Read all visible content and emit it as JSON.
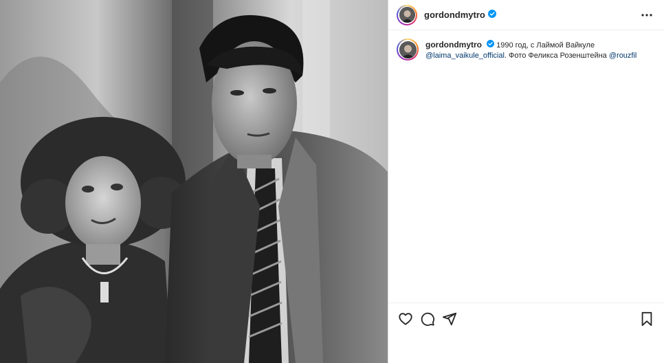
{
  "post": {
    "username": "gordondmytro",
    "verified": true,
    "caption": {
      "text_main": "1990 год, с Лаймой Вайкуле",
      "mention_1": "@laima_vaikule_official",
      "text_mid": ". Фото Феликса Розенштейна ",
      "mention_2": "@rouzfil"
    }
  },
  "icons": {
    "verified": "verified-badge-icon",
    "more": "more-options-icon",
    "like": "heart-icon",
    "comment": "comment-icon",
    "share": "share-icon",
    "save": "bookmark-icon"
  },
  "colors": {
    "verified": "#0095f6",
    "link": "#00376b",
    "text": "#262626"
  }
}
